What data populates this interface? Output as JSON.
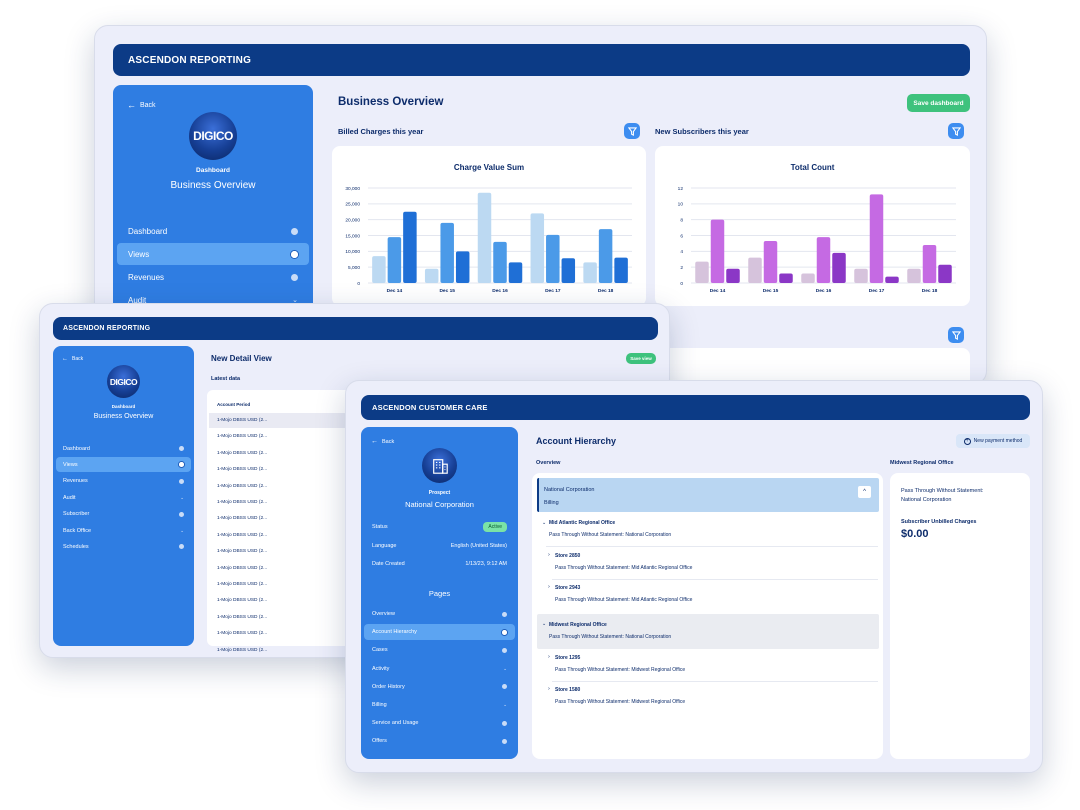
{
  "reporting": {
    "app_title": "ASCENDON REPORTING",
    "back": "Back",
    "logo": "DIGICO",
    "sidebar_caption": "Dashboard",
    "sidebar_title": "Business Overview",
    "nav": [
      {
        "label": "Dashboard",
        "marker": "dot"
      },
      {
        "label": "Views",
        "marker": "selected",
        "active": true
      },
      {
        "label": "Revenues",
        "marker": "dot"
      },
      {
        "label": "Audit",
        "marker": "chevron"
      }
    ],
    "page_title": "Business Overview",
    "save_button": "Save dashboard",
    "billed_title": "Billed Charges this year",
    "subscribers_title": "New Subscribers this year"
  },
  "detail": {
    "app_title": "ASCENDON REPORTING",
    "back": "Back",
    "logo": "DIGICO",
    "sidebar_caption": "Dashboard",
    "sidebar_title": "Business Overview",
    "nav": [
      {
        "label": "Dashboard",
        "marker": "dot"
      },
      {
        "label": "Views",
        "marker": "selected",
        "active": true
      },
      {
        "label": "Revenues",
        "marker": "dot"
      },
      {
        "label": "Audit",
        "marker": "chevron"
      },
      {
        "label": "Subscriber",
        "marker": "dot"
      },
      {
        "label": "Back Office",
        "marker": "chevron"
      },
      {
        "label": "Schedules",
        "marker": "dot"
      }
    ],
    "page_title": "New Detail View",
    "save_button": "Save view",
    "subtitle": "Latest data",
    "column_header": "Account Period",
    "rows": [
      "1-Mojo DBSS USD (2...",
      "1-Mojo DBSS USD (2...",
      "1-Mojo DBSS USD (2...",
      "1-Mojo DBSS USD (2...",
      "1-Mojo DBSS USD (2...",
      "1-Mojo DBSS USD (2...",
      "1-Mojo DBSS USD (2...",
      "1-Mojo DBSS USD (2...",
      "1-Mojo DBSS USD (2...",
      "1-Mojo DBSS USD (2...",
      "1-Mojo DBSS USD (2...",
      "1-Mojo DBSS USD (2...",
      "1-Mojo DBSS USD (2...",
      "1-Mojo DBSS USD (2...",
      "1-Mojo DBSS USD (2..."
    ]
  },
  "care": {
    "app_title": "ASCENDON CUSTOMER CARE",
    "back": "Back",
    "avatar_icon": "building-icon",
    "caption": "Prospect",
    "customer_name": "National Corporation",
    "info": [
      {
        "label": "Status",
        "value": "Active",
        "badge": true
      },
      {
        "label": "Language",
        "value": "English (United States)"
      },
      {
        "label": "Date Created",
        "value": "1/13/23, 9:12 AM"
      }
    ],
    "pages_heading": "Pages",
    "pages": [
      {
        "label": "Overview",
        "marker": "dot"
      },
      {
        "label": "Account Hierarchy",
        "marker": "selected",
        "active": true
      },
      {
        "label": "Cases",
        "marker": "dot"
      },
      {
        "label": "Activity",
        "marker": "chevron"
      },
      {
        "label": "Order History",
        "marker": "dot"
      },
      {
        "label": "Billing",
        "marker": "chevron"
      },
      {
        "label": "Service and Usage",
        "marker": "dot"
      },
      {
        "label": "Offers",
        "marker": "dot"
      }
    ],
    "page_title": "Account Hierarchy",
    "new_payment": "New payment method",
    "overview_label": "Overview",
    "regional_label": "Midwest Regional Office",
    "tree": {
      "root_name": "National Corporation",
      "root_sub": "Billing",
      "groups": [
        {
          "name": "Mid Atlantic Regional Office",
          "sub": "Pass Through Without Statement: National Corporation",
          "stores": [
            {
              "name": "Store 2850",
              "sub": "Pass Through Without Statement: Mid Atlantic  Regional Office"
            },
            {
              "name": "Store 2943",
              "sub": "Pass Through Without Statement: Mid Atlantic  Regional Office"
            }
          ]
        },
        {
          "name": "Midwest Regional Office",
          "sub": "Pass Through Without Statement: National Corporation",
          "stores": [
            {
              "name": "Store 1295",
              "sub": "Pass Through Without Statement: Midwest Regional Office"
            },
            {
              "name": "Store 1580",
              "sub": "Pass Through Without Statement: Midwest Regional Office"
            }
          ]
        }
      ]
    },
    "detail_line1": "Pass Through Without Statement:",
    "detail_line2": "National Corporation",
    "unbilled_label": "Subscriber Unbilled Charges",
    "unbilled_value": "$0.00"
  },
  "chart_data": [
    {
      "type": "bar",
      "title": "Charge Value Sum",
      "categories": [
        "Dec 14",
        "Dec 15",
        "Dec 16",
        "Dec 17",
        "Dec 18"
      ],
      "series": [
        {
          "values": [
            8500,
            4500,
            28500,
            22000,
            6500
          ],
          "color": "#bcd9f2"
        },
        {
          "values": [
            14500,
            19000,
            13000,
            15200,
            17000
          ],
          "color": "#4b9ae8"
        },
        {
          "values": [
            22500,
            10000,
            6500,
            7800,
            8000
          ],
          "color": "#1f6fd6"
        }
      ],
      "ylim": [
        0,
        30000
      ],
      "yticks": [
        0,
        5000,
        10000,
        15000,
        20000,
        25000,
        30000
      ],
      "ytick_labels": [
        "0",
        "5,000",
        "10,000",
        "15,000",
        "20,000",
        "25,000",
        "30,000"
      ],
      "grid": true
    },
    {
      "type": "bar",
      "title": "Total Count",
      "categories": [
        "Dec 14",
        "Dec 15",
        "Dec 16",
        "Dec 17",
        "Dec 18"
      ],
      "series": [
        {
          "values": [
            2.7,
            3.2,
            1.2,
            1.8,
            1.8
          ],
          "color": "#d6c3dc"
        },
        {
          "values": [
            8,
            5.3,
            5.8,
            11.2,
            4.8
          ],
          "color": "#c56ae3"
        },
        {
          "values": [
            1.8,
            1.2,
            3.8,
            0.8,
            2.3
          ],
          "color": "#8b37c6"
        }
      ],
      "ylim": [
        0,
        12
      ],
      "yticks": [
        0,
        2,
        4,
        6,
        8,
        10,
        12
      ],
      "ytick_labels": [
        "0",
        "2",
        "4",
        "6",
        "8",
        "10",
        "12"
      ],
      "grid": true
    }
  ]
}
